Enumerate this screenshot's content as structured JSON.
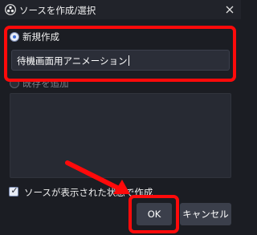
{
  "window": {
    "title": "ソースを作成/選択",
    "close_glyph": "✕"
  },
  "options": {
    "create_new_label": "新規作成",
    "source_name_value": "待機画面用アニメーション",
    "add_existing_label": "既存を追加"
  },
  "checkbox": {
    "label": "ソースが表示された状態で作成",
    "checked": true
  },
  "buttons": {
    "ok_label": "OK",
    "cancel_label": "キャンセル"
  },
  "colors": {
    "annotation": "#ff0a0a",
    "background": "#1b1d23",
    "accent": "#3f6fd6"
  },
  "icons": {
    "app": "obs-logo-icon",
    "close": "close-icon",
    "check": "checkmark-icon",
    "annotation_arrow": "red-arrow-icon"
  }
}
